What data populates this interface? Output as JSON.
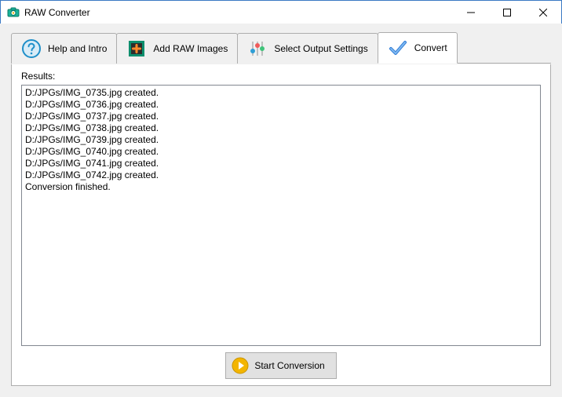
{
  "window": {
    "title": "RAW Converter"
  },
  "tabs": {
    "help": "Help and Intro",
    "add": "Add RAW Images",
    "output": "Select Output Settings",
    "convert": "Convert"
  },
  "panel": {
    "results_label": "Results:",
    "results_lines": [
      "D:/JPGs/IMG_0735.jpg created.",
      "D:/JPGs/IMG_0736.jpg created.",
      "D:/JPGs/IMG_0737.jpg created.",
      "D:/JPGs/IMG_0738.jpg created.",
      "D:/JPGs/IMG_0739.jpg created.",
      "D:/JPGs/IMG_0740.jpg created.",
      "D:/JPGs/IMG_0741.jpg created.",
      "D:/JPGs/IMG_0742.jpg created.",
      "Conversion finished."
    ]
  },
  "buttons": {
    "start": "Start Conversion"
  }
}
